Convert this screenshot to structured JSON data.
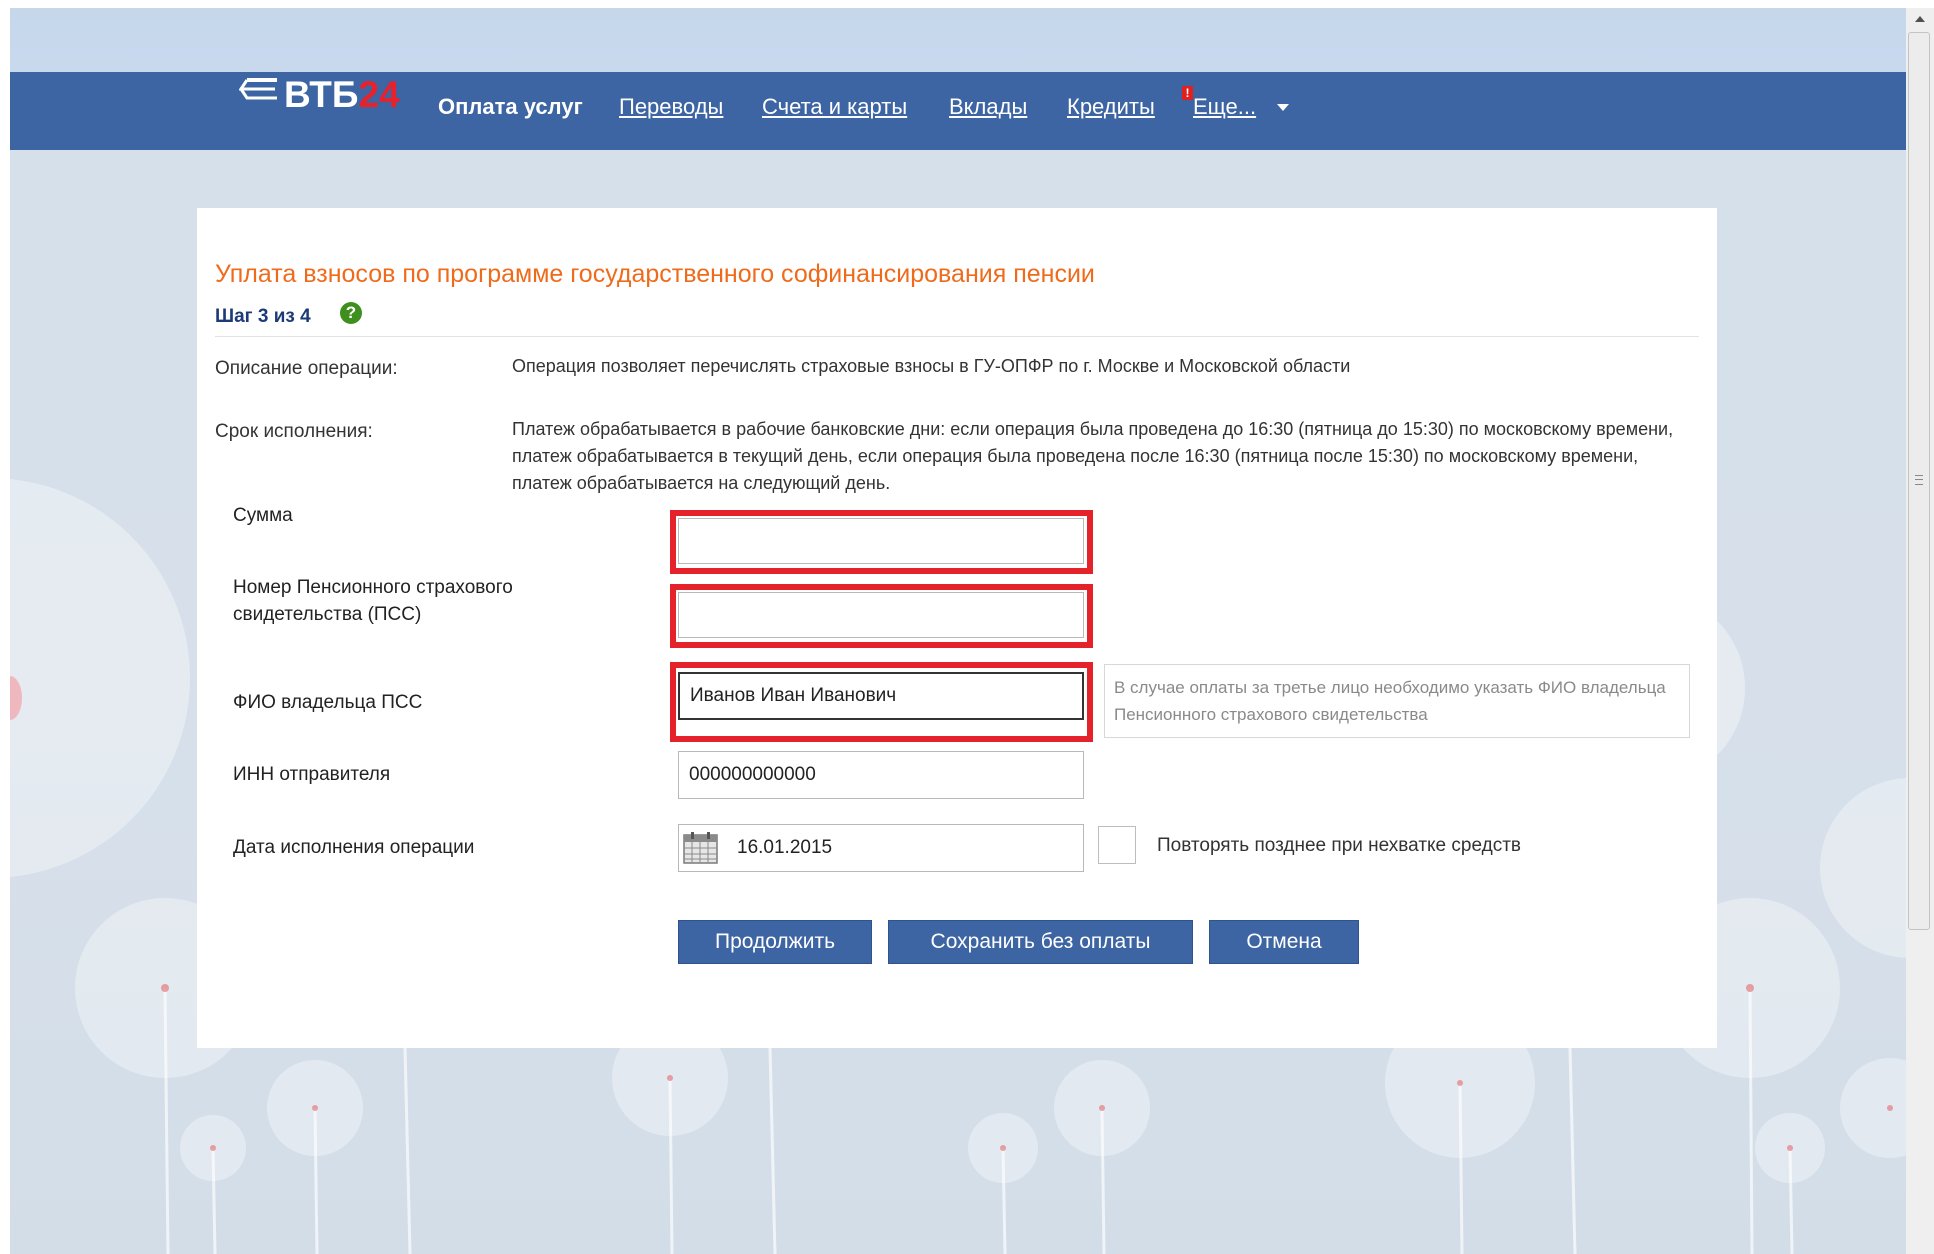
{
  "header": {
    "logo_text": "ВТБ",
    "logo_num": "24",
    "nav": [
      {
        "label": "Оплата услуг"
      },
      {
        "label": "Переводы"
      },
      {
        "label": "Счета и карты"
      },
      {
        "label": "Вклады"
      },
      {
        "label": "Кредиты"
      },
      {
        "label": "Еще..."
      }
    ],
    "badge": "!"
  },
  "form": {
    "title": "Уплата взносов по программе государственного софинансирования пенсии",
    "step": "Шаг 3 из 4",
    "help": "?",
    "description_label": "Описание операции:",
    "description_text": "Операция позволяет перечислять страховые взносы в ГУ-ОПФР по г. Москве и Московской области",
    "deadline_label": "Срок исполнения:",
    "deadline_text": "Платеж обрабатывается в рабочие банковские дни: если операция была проведена до 16:30 (пятница до 15:30) по московскому времени, платеж обрабатывается в текущий день, если операция была проведена после 16:30 (пятница после 15:30) по московскому времени, платеж обрабатывается на следующий день.",
    "fields": {
      "amount_label": "Сумма",
      "amount_value": "",
      "pss_label": "Номер Пенсионного страхового свидетельства (ПСС)",
      "pss_value": "",
      "owner_label": "ФИО владельца ПСС",
      "owner_value": "Иванов Иван Иванович",
      "owner_hint": "В случае оплаты за третье лицо необходимо указать ФИО владельца Пенсионного страхового свидетельства",
      "inn_label": "ИНН отправителя",
      "inn_value": "000000000000",
      "date_label": "Дата исполнения операции",
      "date_value": "16.01.2015",
      "repeat_label": "Повторять позднее при нехватке средств",
      "repeat_checked": false
    },
    "buttons": {
      "continue": "Продолжить",
      "save": "Сохранить без оплаты",
      "cancel": "Отмена"
    }
  },
  "colors": {
    "nav_bg": "#3d65a3",
    "title": "#ef6b1c",
    "step": "#1d3a78",
    "highlight": "#e5222a"
  }
}
